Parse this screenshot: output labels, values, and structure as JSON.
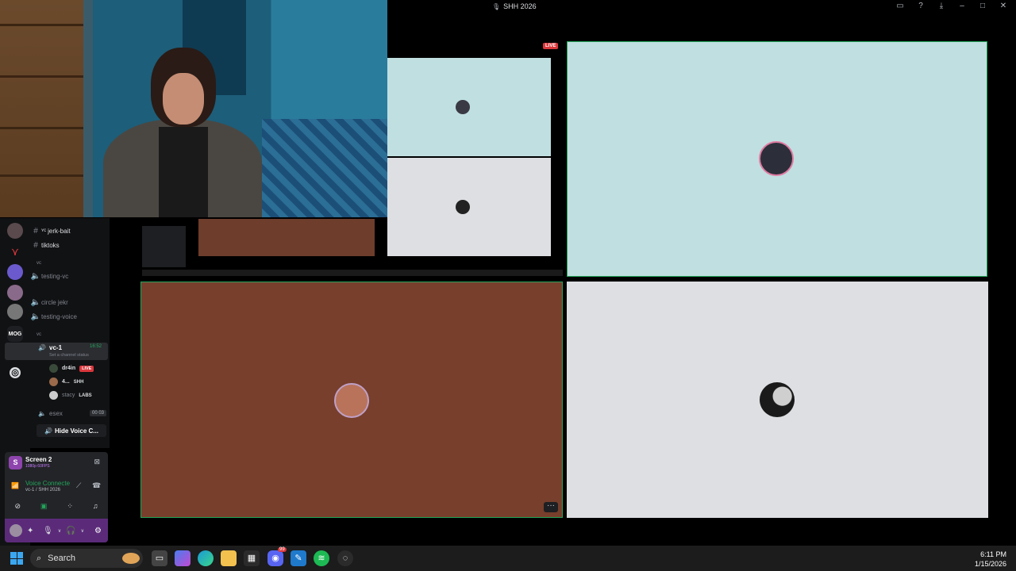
{
  "window": {
    "title": "SHH 2026"
  },
  "live_badge": "LIVE",
  "channels": {
    "text": [
      {
        "prefix": "ʏᴄ",
        "name": "jerk-bait"
      },
      {
        "prefix": "",
        "name": "tiktoks"
      }
    ],
    "category_vc": "vc",
    "voice_top": [
      "testing-vc"
    ],
    "voice_mid": [
      "circle jekr",
      "testing-voice"
    ],
    "category_vc2": "vc",
    "active": {
      "name": "vc-1",
      "time": "16:52",
      "status": "Set a channel status"
    },
    "members": [
      {
        "name": "dr4in",
        "tag": "LIVE"
      },
      {
        "name": "4...",
        "tag": "SHH"
      },
      {
        "name": "stacy",
        "tag": "LABS"
      }
    ],
    "esex": {
      "name": "esex",
      "count": "00 03"
    },
    "hide_button": "Hide Voice C..."
  },
  "panel": {
    "screen_title": "Screen 2",
    "screen_sub": "1080p 60FPS",
    "voice_connected": "Voice Connecte",
    "voice_location": "vc-1 / SHH 2026"
  },
  "taskbar": {
    "search_label": "Search",
    "discord_badge": "99",
    "time": "6:11 PM",
    "date": "1/15/2026"
  },
  "colors": {
    "tile_blue": "#c0dfe0",
    "tile_grey": "#dddfe2",
    "tile_brown": "#773f2c",
    "speaking_border": "#23a55a",
    "live_red": "#da373c"
  }
}
